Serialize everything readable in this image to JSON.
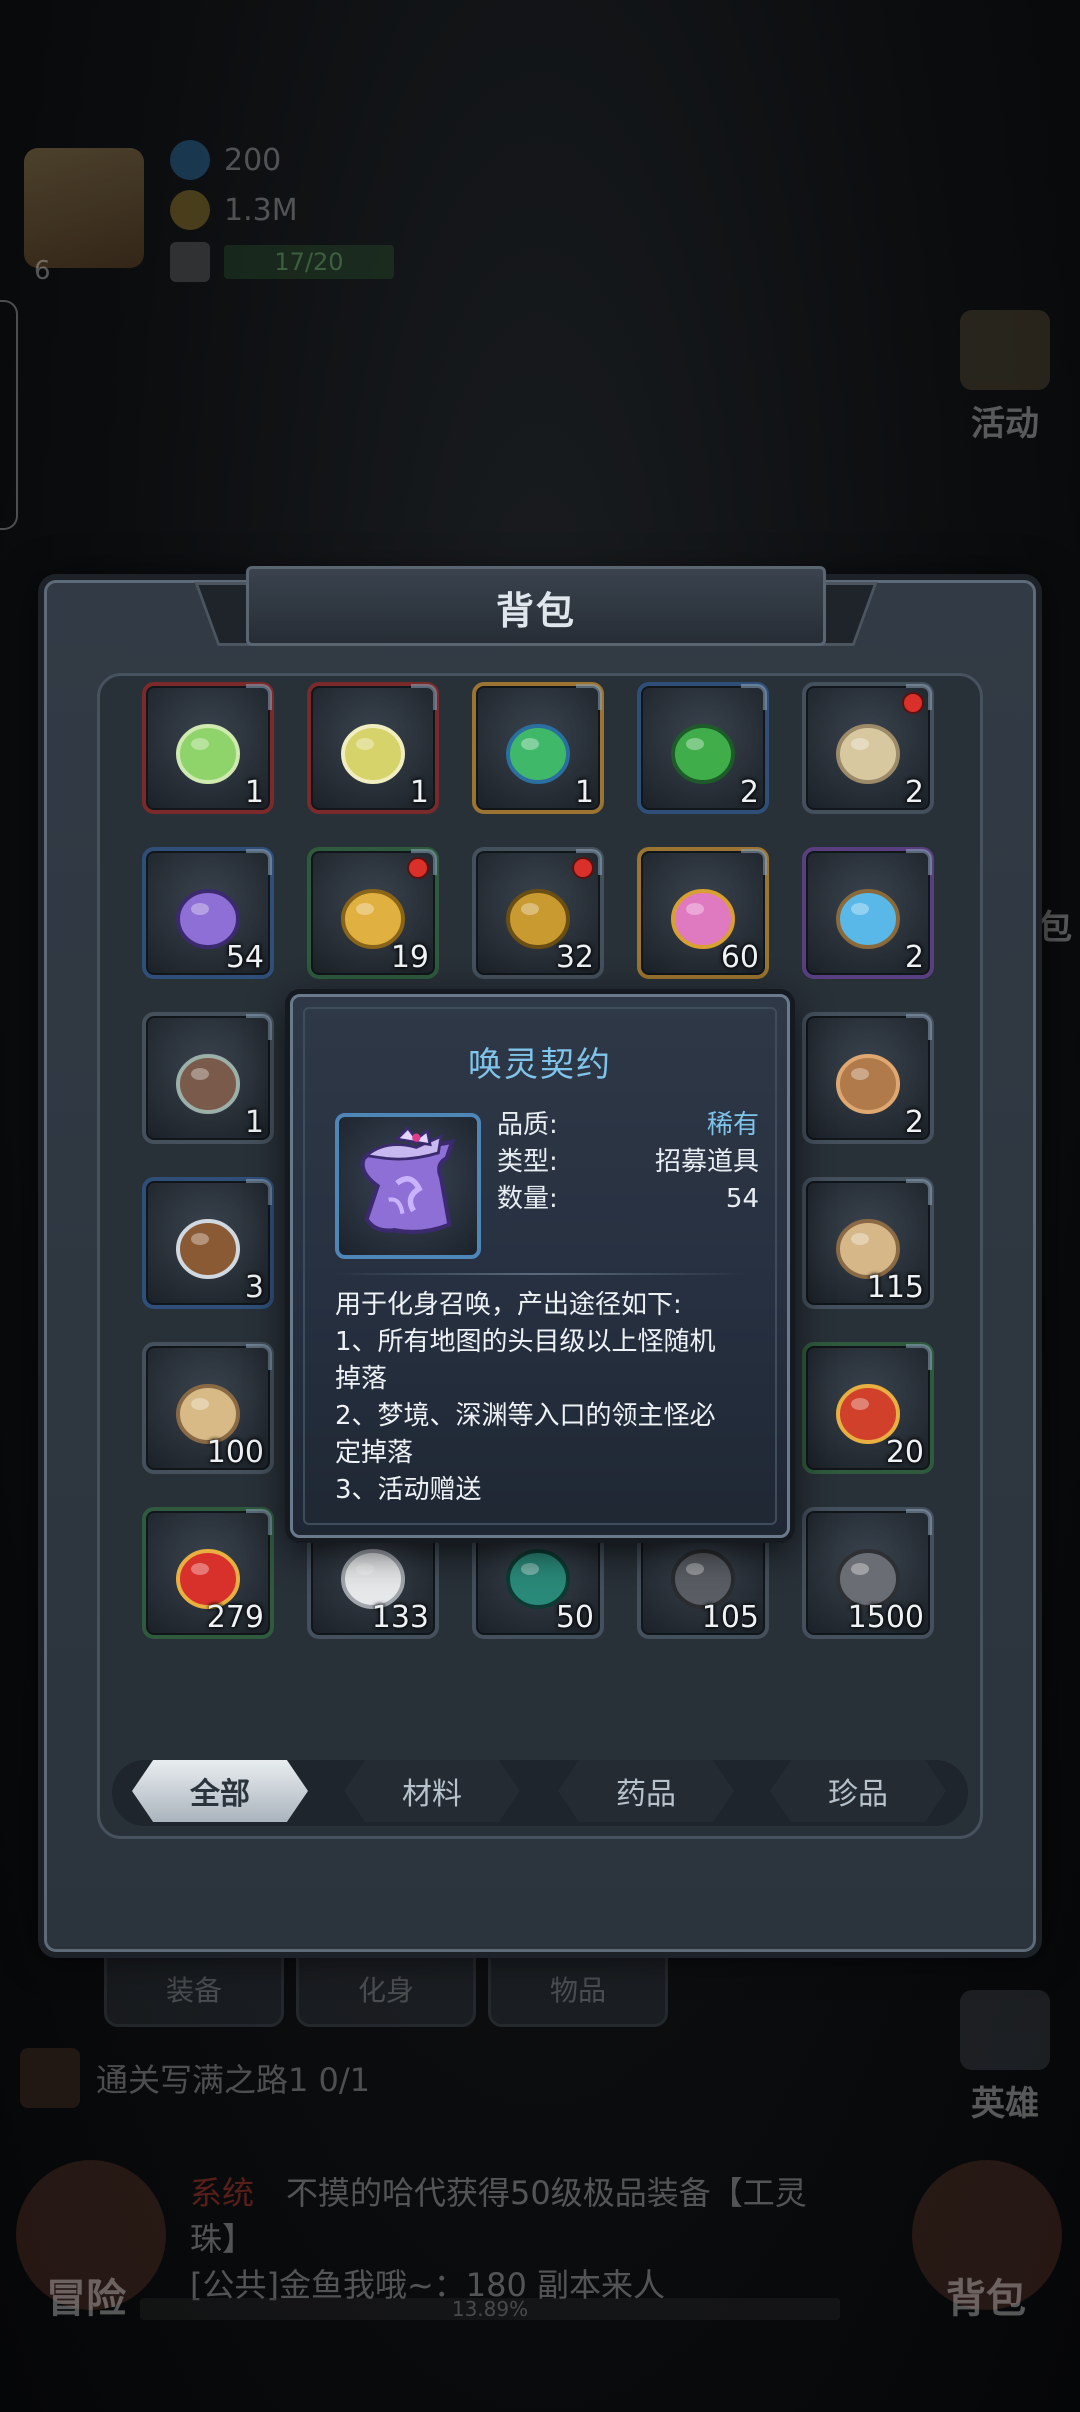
{
  "hud": {
    "level": "6",
    "gems": "200",
    "gold": "1.3M",
    "stamina": "17/20",
    "activity_label": "活动",
    "hero_label": "英雄",
    "bag_corner_label": "包",
    "bottom_tabs": [
      "装备",
      "化身",
      "物品"
    ],
    "quest_text": "通关写满之路1 0/1",
    "news_prefix": "系统",
    "news_line1": "不摸的哈代获得50级极品装备【工灵",
    "news_line2": "珠】",
    "news_line3": "[公共]金鱼我哦~：180 副本来人",
    "adventure_label": "冒险",
    "bag_label": "背包",
    "xp_text": "13.89%"
  },
  "backpack": {
    "title": "背包",
    "items": [
      {
        "count": "1",
        "quality": "red",
        "art": "potion-green-icon",
        "dot": false
      },
      {
        "count": "1",
        "quality": "red",
        "art": "potion-yellow-icon",
        "dot": false
      },
      {
        "count": "1",
        "quality": "gold",
        "art": "potion-large-icon",
        "dot": false
      },
      {
        "count": "2",
        "quality": "blue",
        "art": "potion-bottle-icon",
        "dot": false
      },
      {
        "count": "2",
        "quality": "none",
        "art": "scroll-icon",
        "dot": true
      },
      {
        "count": "54",
        "quality": "blue",
        "art": "summon-contract-icon",
        "dot": false
      },
      {
        "count": "19",
        "quality": "green",
        "art": "gold-bar-icon",
        "dot": true
      },
      {
        "count": "32",
        "quality": "none",
        "art": "gold-ore-icon",
        "dot": true
      },
      {
        "count": "60",
        "quality": "gold",
        "art": "gem-lamp-icon",
        "dot": false
      },
      {
        "count": "2",
        "quality": "purple",
        "art": "crystal-chest-icon",
        "dot": false
      },
      {
        "count": "1",
        "quality": "none",
        "art": "emblem-icon",
        "dot": false
      },
      {
        "count": "2",
        "quality": "none",
        "art": "cross-icon",
        "dot": false
      },
      {
        "count": "3",
        "quality": "blue",
        "art": "winged-boot-icon",
        "dot": false
      },
      {
        "count": "115",
        "quality": "none",
        "art": "scroll-sword-icon",
        "dot": false
      },
      {
        "count": "100",
        "quality": "none",
        "art": "scroll-blade-icon",
        "dot": false
      },
      {
        "count": "20",
        "quality": "green",
        "art": "shield-gem-icon",
        "dot": false
      },
      {
        "count": "279",
        "quality": "green",
        "art": "winged-ruby-icon",
        "dot": false
      },
      {
        "count": "133",
        "quality": "none",
        "art": "white-powder-icon",
        "dot": false
      },
      {
        "count": "50",
        "quality": "none",
        "art": "green-gem-icon",
        "dot": false
      },
      {
        "count": "105",
        "quality": "none",
        "art": "dark-ore-icon",
        "dot": false
      },
      {
        "count": "1500",
        "quality": "none",
        "art": "stone-pile-icon",
        "dot": false
      }
    ],
    "tabs": [
      "全部",
      "材料",
      "药品",
      "珍品"
    ],
    "active_tab": "全部"
  },
  "tooltip": {
    "name": "唤灵契约",
    "quality_label": "品质:",
    "quality_value": "稀有",
    "type_label": "类型:",
    "type_value": "招募道具",
    "amount_label": "数量:",
    "amount_value": "54",
    "desc_lines": [
      "用于化身召唤，产出途径如下:",
      "1、所有地图的头目级以上怪随机",
      "掉落",
      "2、梦境、深渊等入口的领主怪必",
      "定掉落",
      "3、活动赠送"
    ]
  },
  "colors": {
    "tooltip_title": "#7fc4ea",
    "rare": "#7fc4ea",
    "red_dot": "#d9302a"
  }
}
